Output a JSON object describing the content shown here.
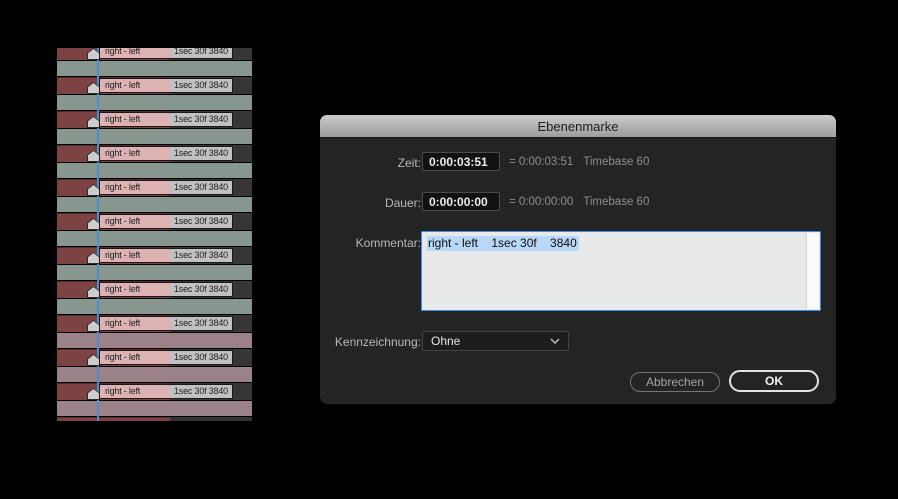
{
  "dialog": {
    "title": "Ebenenmarke",
    "accent_color": "#3e8de5",
    "selection_color": "#b9d8f8",
    "fields": {
      "time_label": "Zeit:",
      "time_value": "0:00:03:51",
      "time_equals": "= 0:00:03:51",
      "duration_label": "Dauer:",
      "duration_value": "0:00:00:00",
      "duration_equals": "= 0:00:00:00",
      "timebase": "Timebase 60",
      "comment_label": "Kommentar:",
      "comment_value": "right - left    1sec 30f    3840",
      "label_label": "Kennzeichnung:",
      "label_value": "Ohne"
    },
    "buttons": {
      "cancel": "Abbrechen",
      "ok": "OK"
    }
  },
  "timeline": {
    "marker_text": {
      "comment": "right - left",
      "duration": "1sec 30f",
      "value": "3840"
    },
    "colors": {
      "sage": "#87968e",
      "mauve": "#9a818a",
      "layer_bar": "#7d4343",
      "chip_comment_bg": "#dcb2b3",
      "chip_info_bg": "#c2c1c1",
      "marker_fill": "#cdcdcd",
      "playhead": "#4a8fd3",
      "row_bg": "#363636"
    },
    "rows": [
      {
        "type": "chip",
        "partial": "top"
      },
      {
        "type": "band",
        "color": "sage"
      },
      {
        "type": "chip"
      },
      {
        "type": "band",
        "color": "sage"
      },
      {
        "type": "chip"
      },
      {
        "type": "band",
        "color": "sage"
      },
      {
        "type": "chip"
      },
      {
        "type": "band",
        "color": "sage"
      },
      {
        "type": "chip"
      },
      {
        "type": "band",
        "color": "sage"
      },
      {
        "type": "chip"
      },
      {
        "type": "band",
        "color": "sage"
      },
      {
        "type": "chip"
      },
      {
        "type": "band",
        "color": "sage"
      },
      {
        "type": "chip"
      },
      {
        "type": "band",
        "color": "sage"
      },
      {
        "type": "chip"
      },
      {
        "type": "band",
        "color": "mauve"
      },
      {
        "type": "chip"
      },
      {
        "type": "band",
        "color": "mauve"
      },
      {
        "type": "chip"
      },
      {
        "type": "band",
        "color": "mauve"
      },
      {
        "type": "barstub"
      }
    ]
  }
}
